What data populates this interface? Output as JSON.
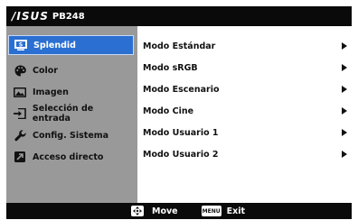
{
  "header": {
    "brand": "/ISUS",
    "model": "PB248"
  },
  "sidebar": {
    "items": [
      {
        "label": "Splendid",
        "icon": "splendid-icon",
        "active": true
      },
      {
        "label": "Color",
        "icon": "palette-icon",
        "active": false
      },
      {
        "label": "Imagen",
        "icon": "image-icon",
        "active": false
      },
      {
        "label": "Selección de entrada",
        "icon": "input-select-icon",
        "active": false
      },
      {
        "label": "Config. Sistema",
        "icon": "wrench-icon",
        "active": false
      },
      {
        "label": "Acceso directo",
        "icon": "shortcut-icon",
        "active": false
      }
    ]
  },
  "options": [
    {
      "label": "Modo Estándar"
    },
    {
      "label": "Modo sRGB"
    },
    {
      "label": "Modo Escenario"
    },
    {
      "label": "Modo Cine"
    },
    {
      "label": "Modo Usuario 1"
    },
    {
      "label": "Modo Usuario 2"
    }
  ],
  "footer": {
    "move_label": "Move",
    "menu_key": "MENU",
    "exit_label": "Exit"
  },
  "colors": {
    "accent": "#2a6fd1",
    "titlebar": "#0a0a0a",
    "sidebar": "#999999"
  }
}
